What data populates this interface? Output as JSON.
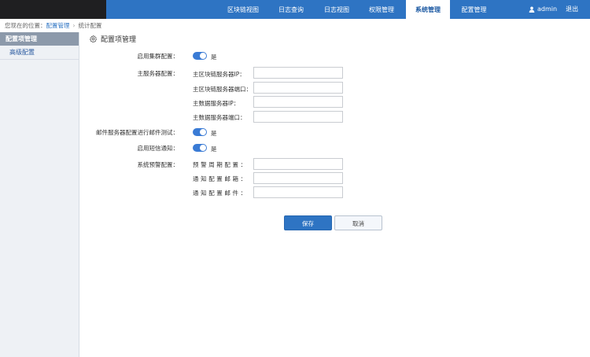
{
  "nav": {
    "items": [
      {
        "label": "区块链视图"
      },
      {
        "label": "日志查询"
      },
      {
        "label": "日志视图"
      },
      {
        "label": "权限管理"
      },
      {
        "label": "系统管理",
        "active": true
      },
      {
        "label": "配置管理"
      }
    ],
    "user": "admin",
    "logout": "退出"
  },
  "breadcrumb": {
    "prefix": "您现在的位置：",
    "level1": "配置管理",
    "sep": "›",
    "level2": "统计配置"
  },
  "sidebar": {
    "header": "配置项管理",
    "items": [
      "高级配置"
    ]
  },
  "main": {
    "title": "配置项管理",
    "cluster": {
      "label": "启用集群配置：",
      "toggle_text": "是",
      "on": true
    },
    "master": {
      "label": "主服务器配置：",
      "fields": [
        {
          "label": "主区块链服务器IP：",
          "value": ""
        },
        {
          "label": "主区块链服务器端口：",
          "value": ""
        },
        {
          "label": "主数据服务器IP：",
          "value": ""
        },
        {
          "label": "主数据服务器端口：",
          "value": ""
        }
      ]
    },
    "mail_test": {
      "label": "邮件服务器配置进行邮件测试：",
      "toggle_text": "是",
      "on": true
    },
    "sms": {
      "label": "启用短信通知：",
      "toggle_text": "是",
      "on": true
    },
    "alert": {
      "label": "系统预警配置：",
      "fields": [
        {
          "label": "预警周期配置：",
          "value": ""
        },
        {
          "label": "通知配置邮箱：",
          "value": ""
        },
        {
          "label": "通知配置邮件：",
          "value": ""
        }
      ]
    },
    "buttons": {
      "save": "保存",
      "cancel": "取消"
    }
  },
  "colors": {
    "accent": "#2e74c3",
    "topbar": "#2e74c3",
    "brand_block": "#1f1f21",
    "sidebar_header": "#8c99aa",
    "toggle_on": "#3a7bd5"
  }
}
